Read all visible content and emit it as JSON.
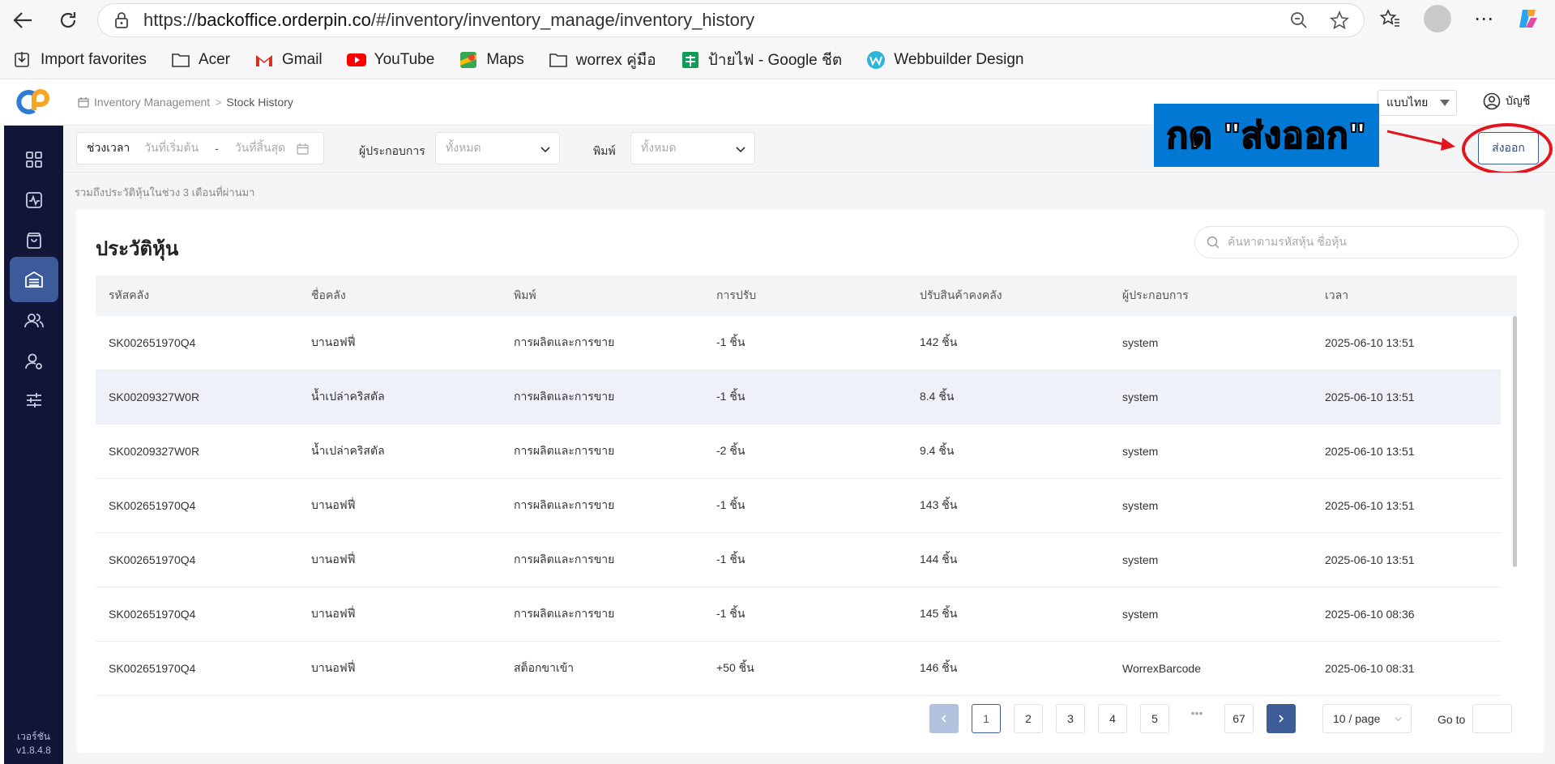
{
  "browser": {
    "url_prefix": "https://",
    "url_host": "backoffice.orderpin.co",
    "url_path": "/#/inventory/inventory_manage/inventory_history",
    "bookmarks": [
      {
        "label": "Import favorites",
        "icon": "import-icon"
      },
      {
        "label": "Acer",
        "icon": "folder-icon"
      },
      {
        "label": "Gmail",
        "icon": "gmail-icon"
      },
      {
        "label": "YouTube",
        "icon": "youtube-icon"
      },
      {
        "label": "Maps",
        "icon": "maps-icon"
      },
      {
        "label": "worrex คู่มือ",
        "icon": "folder-icon"
      },
      {
        "label": "ป้ายไฟ - Google ชีต",
        "icon": "sheets-icon"
      },
      {
        "label": "Webbuilder Design",
        "icon": "webbuilder-icon"
      }
    ]
  },
  "header": {
    "breadcrumb_root": "Inventory Management",
    "breadcrumb_current": "Stock History",
    "language": "แบบไทย",
    "account": "บัญชี"
  },
  "filters": {
    "period_label": "ช่วงเวลา",
    "start_placeholder": "วันที่เริ่มต้น",
    "separator": "-",
    "end_placeholder": "วันที่สิ้นสุด",
    "operator_label": "ผู้ประกอบการ",
    "operator_value": "ทั้งหมด",
    "type_label": "พิมพ์",
    "type_value": "ทั้งหมด"
  },
  "export_label": "ส่งออก",
  "annotation": "กด \"ส่งออก\"",
  "note": "รวมถึงประวัติหุ้นในช่วง 3 เดือนที่ผ่านมา",
  "card": {
    "title": "ประวัติหุ้น",
    "search_placeholder": "ค้นหาตามรหัสหุ้น ชื่อหุ้น"
  },
  "table": {
    "columns": [
      "รหัสคลัง",
      "ชื่อคลัง",
      "พิมพ์",
      "การปรับ",
      "ปรับสินค้าคงคลัง",
      "ผู้ประกอบการ",
      "เวลา"
    ],
    "rows": [
      [
        "SK002651970Q4",
        "บานอฟฟี่",
        "การผลิตและการขาย",
        "-1 ชิ้น",
        "142 ชิ้น",
        "system",
        "2025-06-10 13:51"
      ],
      [
        "SK00209327W0R",
        "น้ำเปล่าคริสตัล",
        "การผลิตและการขาย",
        "-1 ชิ้น",
        "8.4 ชิ้น",
        "system",
        "2025-06-10 13:51"
      ],
      [
        "SK00209327W0R",
        "น้ำเปล่าคริสตัล",
        "การผลิตและการขาย",
        "-2 ชิ้น",
        "9.4 ชิ้น",
        "system",
        "2025-06-10 13:51"
      ],
      [
        "SK002651970Q4",
        "บานอฟฟี่",
        "การผลิตและการขาย",
        "-1 ชิ้น",
        "143 ชิ้น",
        "system",
        "2025-06-10 13:51"
      ],
      [
        "SK002651970Q4",
        "บานอฟฟี่",
        "การผลิตและการขาย",
        "-1 ชิ้น",
        "144 ชิ้น",
        "system",
        "2025-06-10 13:51"
      ],
      [
        "SK002651970Q4",
        "บานอฟฟี่",
        "การผลิตและการขาย",
        "-1 ชิ้น",
        "145 ชิ้น",
        "system",
        "2025-06-10 08:36"
      ],
      [
        "SK002651970Q4",
        "บานอฟฟี่",
        "สต็อกขาเข้า",
        "+50 ชิ้น",
        "146 ชิ้น",
        "WorrexBarcode",
        "2025-06-10 08:31"
      ]
    ]
  },
  "pagination": {
    "pages": [
      "1",
      "2",
      "3",
      "4",
      "5"
    ],
    "ellipsis": "•••",
    "last_page": "67",
    "current_page": "1",
    "page_size": "10 / page",
    "goto_label": "Go to"
  },
  "version": {
    "label": "เวอร์ชัน",
    "number": "v1.8.4.8"
  }
}
